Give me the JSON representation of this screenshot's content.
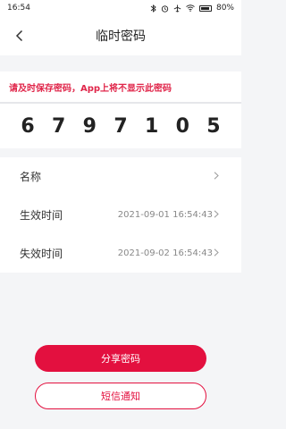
{
  "status_bar": {
    "time": "16:54",
    "battery": "80%",
    "icons": [
      "bluetooth-icon",
      "alarm-icon",
      "airplane-icon",
      "wifi-icon",
      "battery-icon"
    ]
  },
  "nav": {
    "title": "临时密码",
    "back_icon": "chevron-left-icon"
  },
  "warning": {
    "text": "请及时保存密码，App上将不显示此密码",
    "color": "#e0264a"
  },
  "password": {
    "digits": [
      "6",
      "7",
      "9",
      "7",
      "1",
      "0",
      "5"
    ]
  },
  "info": {
    "name_label": "名称",
    "start_label": "生效时间",
    "start_value": "2021-09-01 16:54:43",
    "end_label": "失效时间",
    "end_value": "2021-09-02 16:54:43"
  },
  "actions": {
    "share_label": "分享密码",
    "sms_label": "短信通知",
    "accent_color": "#e3103f"
  }
}
